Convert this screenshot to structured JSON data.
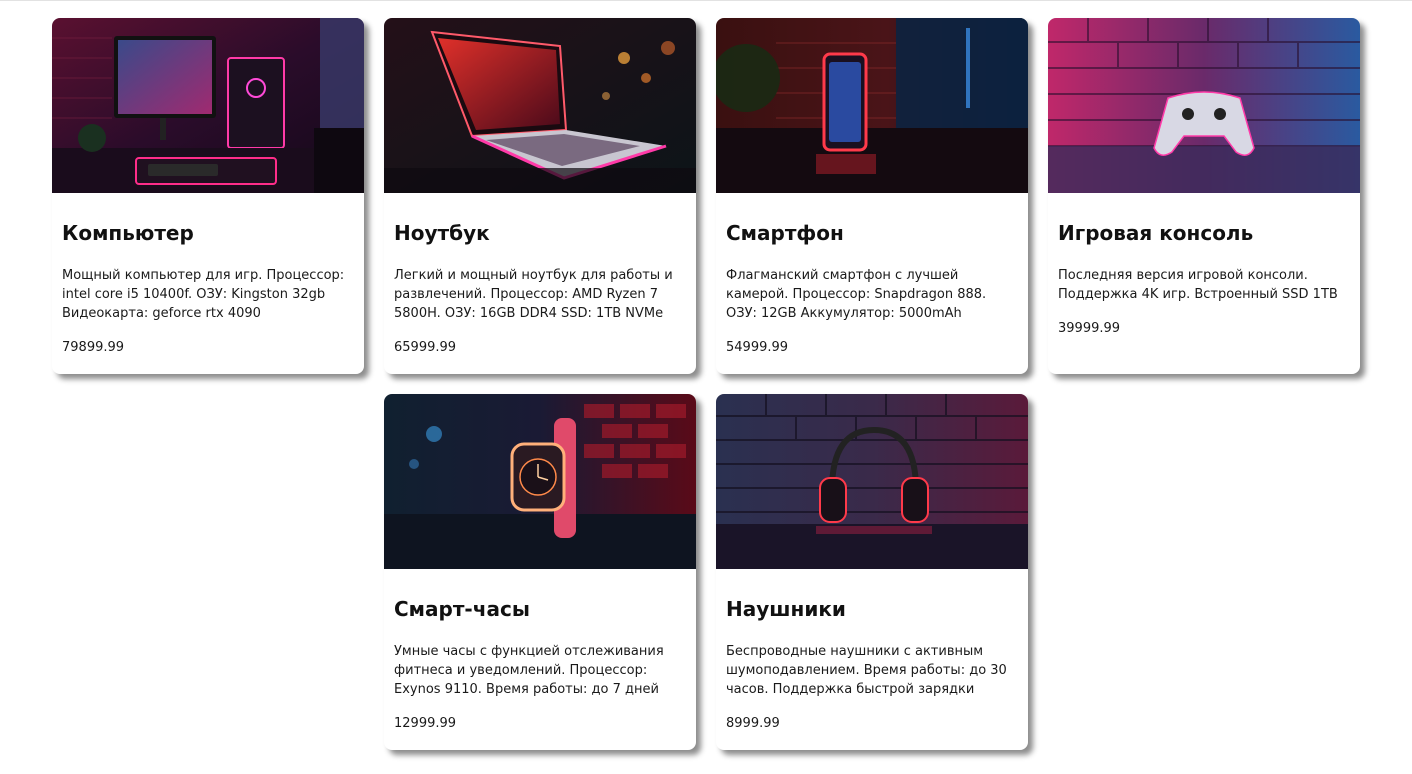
{
  "products": [
    {
      "title": "Компьютер",
      "description": "Мощный компьютер для игр. Процессор: intel core i5 10400f. ОЗУ: Kingston 32gb Видеокарта: geforce rtx 4090",
      "price": "79899.99",
      "image_icon": "gaming-pc-setup-image"
    },
    {
      "title": "Ноутбук",
      "description": "Легкий и мощный ноутбук для работы и развлечений. Процессор: AMD Ryzen 7 5800H. ОЗУ: 16GB DDR4 SSD: 1TB NVMe",
      "price": "65999.99",
      "image_icon": "laptop-image"
    },
    {
      "title": "Смартфон",
      "description": "Флагманский смартфон с лучшей камерой. Процессор: Snapdragon 888. ОЗУ: 12GB Аккумулятор: 5000mAh",
      "price": "54999.99",
      "image_icon": "smartphone-image"
    },
    {
      "title": "Игровая консоль",
      "description": "Последняя версия игровой консоли. Поддержка 4K игр. Встроенный SSD 1TB",
      "price": "39999.99",
      "image_icon": "gamepad-image"
    },
    {
      "title": "Смарт-часы",
      "description": "Умные часы с функцией отслеживания фитнеса и уведомлений. Процессор: Exynos 9110. Время работы: до 7 дней",
      "price": "12999.99",
      "image_icon": "smartwatch-image"
    },
    {
      "title": "Наушники",
      "description": "Беспроводные наушники с активным шумоподавлением. Время работы: до 30 часов. Поддержка быстрой зарядки",
      "price": "8999.99",
      "image_icon": "headphones-image"
    }
  ],
  "colors": {
    "neon_pink": "#ff2d8a",
    "neon_blue": "#2a7bd6",
    "dark_bg": "#140a1e"
  }
}
